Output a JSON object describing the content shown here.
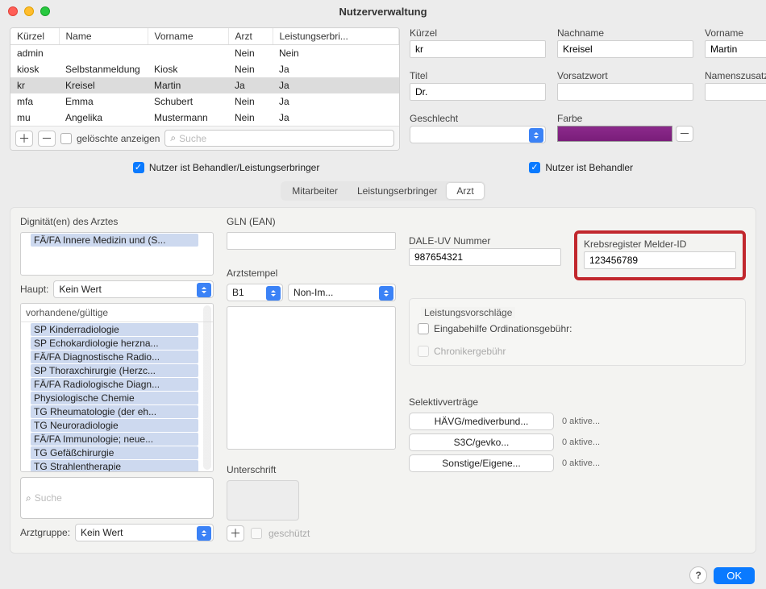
{
  "window": {
    "title": "Nutzerverwaltung"
  },
  "table": {
    "columns": [
      "Kürzel",
      "Name",
      "Vorname",
      "Arzt",
      "Leistungserbri..."
    ],
    "rows": [
      {
        "kurzel": "admin",
        "name": "",
        "vorname": "",
        "arzt": "Nein",
        "leist": "Nein"
      },
      {
        "kurzel": "kiosk",
        "name": "Selbstanmeldung",
        "vorname": "Kiosk",
        "arzt": "Nein",
        "leist": "Ja"
      },
      {
        "kurzel": "kr",
        "name": "Kreisel",
        "vorname": "Martin",
        "arzt": "Ja",
        "leist": "Ja",
        "selected": true
      },
      {
        "kurzel": "mfa",
        "name": "Emma",
        "vorname": "Schubert",
        "arzt": "Nein",
        "leist": "Ja"
      },
      {
        "kurzel": "mu",
        "name": "Angelika",
        "vorname": "Mustermann",
        "arzt": "Nein",
        "leist": "Ja"
      }
    ],
    "footer": {
      "show_deleted": "gelöschte anzeigen",
      "search_placeholder": "Suche"
    }
  },
  "details": {
    "kurzel_label": "Kürzel",
    "kurzel": "kr",
    "nachname_label": "Nachname",
    "nachname": "Kreisel",
    "vorname_label": "Vorname",
    "vorname": "Martin",
    "titel_label": "Titel",
    "titel": "Dr.",
    "vorsatz_label": "Vorsatzwort",
    "vorsatz": "",
    "zusatz_label": "Namenszusatz",
    "zusatz": "",
    "geschlecht_label": "Geschlecht",
    "geschlecht": "",
    "farbe_label": "Farbe",
    "farbe": "#7d2a7d"
  },
  "flags": {
    "leistungserbringer": "Nutzer ist Behandler/Leistungserbringer",
    "behandler": "Nutzer ist Behandler"
  },
  "tabs": {
    "mitarbeiter": "Mitarbeiter",
    "leistungserbringer": "Leistungserbringer",
    "arzt": "Arzt"
  },
  "arzt": {
    "dign_label": "Dignität(en) des Arztes",
    "dign_selected": "FÄ/FA Innere Medizin und (S...",
    "haupt_label": "Haupt:",
    "haupt_value": "Kein Wert",
    "vorhandene_label": "vorhandene/gültige",
    "vorhandene": [
      "SP Kinderradiologie",
      "SP Echokardiologie herzna...",
      "FÄ/FA Diagnostische Radio...",
      "SP Thoraxchirurgie (Herzc...",
      "FÄ/FA Radiologische Diagn...",
      "Physiologische Chemie",
      "TG Rheumatologie (der eh...",
      "TG Neuroradiologie",
      "FÄ/FA Immunologie; neue...",
      "TG Gefäßchirurgie",
      "TG Strahlentherapie"
    ],
    "search_placeholder": "Suche",
    "arztgruppe_label": "Arztgruppe:",
    "arztgruppe_value": "Kein Wert",
    "gln_label": "GLN (EAN)",
    "gln": "",
    "stempel_label": "Arztstempel",
    "stempel_sel": "B1",
    "stempel_mode": "Non-Im...",
    "unterschrift_label": "Unterschrift",
    "geschuetzt": "geschützt",
    "dale_label": "DALE-UV Nummer",
    "dale": "987654321",
    "krebs_label": "Krebsregister Melder-ID",
    "krebs": "123456789",
    "lv_header": "Leistungsvorschläge",
    "lv_ordination": "Eingabehilfe Ordinationsgebühr:",
    "lv_chroniker": "Chronikergebühr",
    "sel_header": "Selektivverträge",
    "sel": [
      {
        "label": "HÄVG/mediverbund...",
        "status": "0 aktive..."
      },
      {
        "label": "S3C/gevko...",
        "status": "0 aktive..."
      },
      {
        "label": "Sonstige/Eigene...",
        "status": "0 aktive..."
      }
    ]
  },
  "footer": {
    "ok": "OK"
  }
}
